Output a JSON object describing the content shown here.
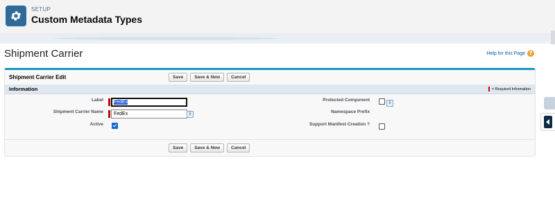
{
  "header": {
    "setup_label": "SETUP",
    "title": "Custom Metadata Types",
    "icon": "gear-icon",
    "accent": "#2f6b99"
  },
  "record": {
    "title": "Shipment Carrier",
    "help_link": "Help for this Page",
    "help_icon": "question-icon"
  },
  "panel": {
    "title": "Shipment Carrier Edit",
    "buttons": {
      "save": "Save",
      "save_new": "Save & New",
      "cancel": "Cancel"
    },
    "section_title": "Information",
    "required_note": "= Required Information"
  },
  "fields": {
    "label": {
      "label": "Label",
      "value": "FedEx"
    },
    "carrier_name": {
      "label": "Shipment Carrier Name",
      "value": "FedEx"
    },
    "active": {
      "label": "Active",
      "checked": true
    },
    "protected": {
      "label": "Protected Component",
      "checked": false
    },
    "namespace": {
      "label": "Namespace Prefix",
      "value": ""
    },
    "manifest": {
      "label": "Support Manifest Creation ?",
      "checked": false
    }
  },
  "colors": {
    "panel_top_border": "#1797c0",
    "section_bar": "#dfe8f0",
    "required": "#c00000",
    "checkbox_checked": "#1467d3"
  }
}
